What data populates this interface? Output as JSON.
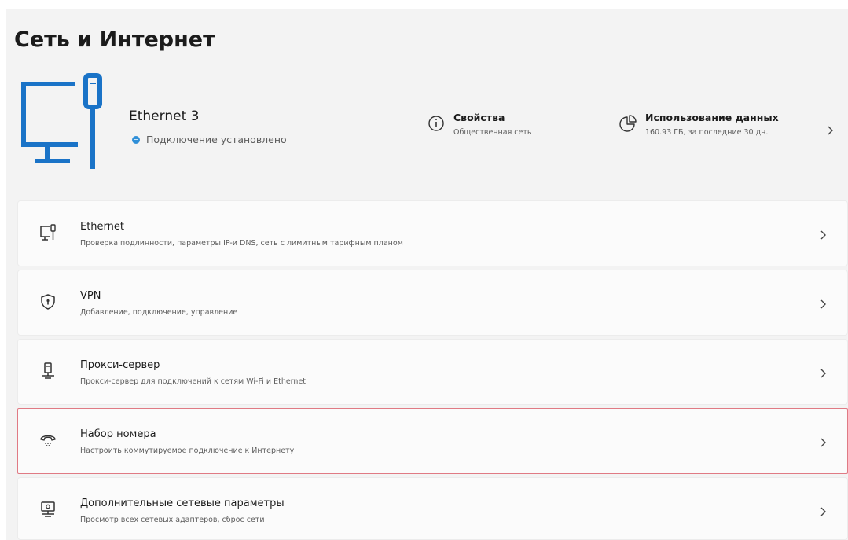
{
  "page": {
    "title": "Сеть и Интернет"
  },
  "hero": {
    "icon": "ethernet-monitor-icon",
    "device_name": "Ethernet 3",
    "status": "Подключение установлено",
    "status_color": "#2f8fd8",
    "actions": [
      {
        "icon": "info-icon",
        "title": "Свойства",
        "subtitle": "Общественная сеть"
      },
      {
        "icon": "pie-chart-icon",
        "title": "Использование данных",
        "subtitle": "160.93 ГБ, за последние 30 дн."
      }
    ]
  },
  "settings": [
    {
      "icon": "ethernet-icon",
      "title": "Ethernet",
      "subtitle": "Проверка подлинности, параметры IP-и DNS, сеть с лимитным тарифным планом"
    },
    {
      "icon": "vpn-shield-icon",
      "title": "VPN",
      "subtitle": "Добавление, подключение, управление"
    },
    {
      "icon": "proxy-server-icon",
      "title": "Прокси-сервер",
      "subtitle": "Прокси-сервер для подключений к сетям Wi-Fi и Ethernet"
    },
    {
      "icon": "dial-up-phone-icon",
      "title": "Набор номера",
      "subtitle": "Настроить коммутируемое подключение к Интернету",
      "highlighted": true
    },
    {
      "icon": "network-monitor-icon",
      "title": "Дополнительные сетевые параметры",
      "subtitle": "Просмотр всех сетевых адаптеров, сброс сети"
    }
  ],
  "colors": {
    "accent": "#1a73c7",
    "highlight_border": "#e07a84",
    "background": "#f3f3f3",
    "card": "#fbfbfb"
  }
}
